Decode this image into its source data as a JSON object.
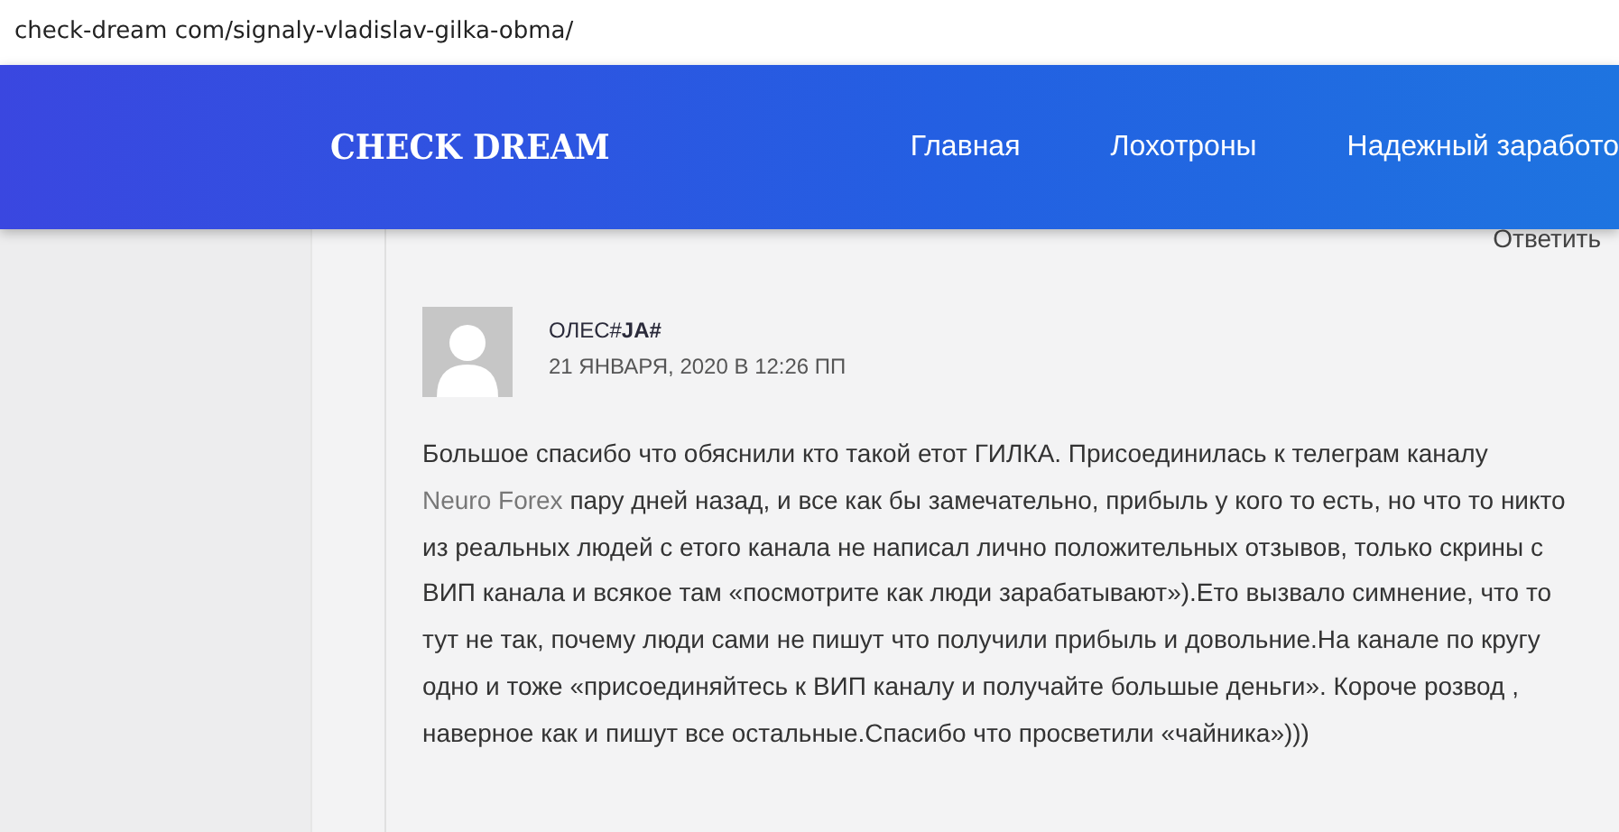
{
  "address_bar": {
    "url": "check-dream com/signaly-vladislav-gilka-obma/"
  },
  "header": {
    "logo": "CHECK DREAM",
    "nav": [
      {
        "label": "Главная"
      },
      {
        "label": "Лохотроны"
      },
      {
        "label": "Надежный заработо"
      }
    ]
  },
  "reply_link": "Ответить",
  "comment": {
    "author": "ОЛЕС#**JA#**",
    "date": "21 ЯНВАРЯ, 2020 В 12:26 ПП",
    "text_before": "Большое спасибо что обяснили кто такой етот ГИЛКА. Присоединилась к телеграм каналу ",
    "link": "Neuro Forex",
    "text_after": " пару дней назад, и все как бы замечательно, прибыль у кого то есть, но что то никто из реальных людей с етого канала не написал лично положительных отзывов, только скрины с ВИП канала и всякое там «посмотрите как люди зарабатывают»).Ето вызвало симнение, что то тут не так, почему люди сами не пишут что получили прибыль и довольние.На канале по кругу одно и тоже «присоединяйтесь к ВИП каналу и получайте большые деньги». Короче розвод , наверное как и пишут все остальные.Спасибо что просветили «чайника»)))"
  }
}
